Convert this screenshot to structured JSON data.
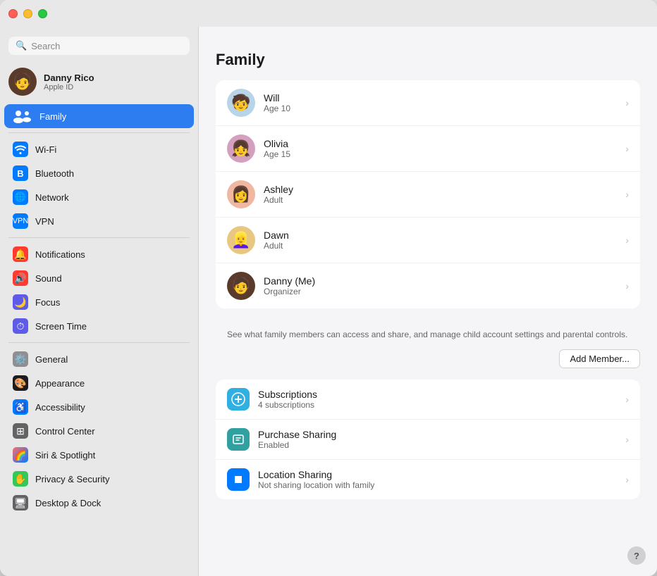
{
  "window": {
    "title": "Family"
  },
  "titlebar": {
    "red": "close",
    "yellow": "minimize",
    "green": "maximize"
  },
  "sidebar": {
    "search": {
      "placeholder": "Search"
    },
    "user": {
      "name": "Danny Rico",
      "subtitle": "Apple ID"
    },
    "items": [
      {
        "id": "family",
        "label": "Family",
        "icon": "family",
        "active": true
      },
      {
        "id": "wifi",
        "label": "Wi-Fi",
        "icon": "wifi"
      },
      {
        "id": "bluetooth",
        "label": "Bluetooth",
        "icon": "bluetooth"
      },
      {
        "id": "network",
        "label": "Network",
        "icon": "network"
      },
      {
        "id": "vpn",
        "label": "VPN",
        "icon": "vpn"
      },
      {
        "id": "notifications",
        "label": "Notifications",
        "icon": "notifications"
      },
      {
        "id": "sound",
        "label": "Sound",
        "icon": "sound"
      },
      {
        "id": "focus",
        "label": "Focus",
        "icon": "focus"
      },
      {
        "id": "screentime",
        "label": "Screen Time",
        "icon": "screentime"
      },
      {
        "id": "general",
        "label": "General",
        "icon": "general"
      },
      {
        "id": "appearance",
        "label": "Appearance",
        "icon": "appearance"
      },
      {
        "id": "accessibility",
        "label": "Accessibility",
        "icon": "accessibility"
      },
      {
        "id": "controlcenter",
        "label": "Control Center",
        "icon": "controlcenter"
      },
      {
        "id": "siri",
        "label": "Siri & Spotlight",
        "icon": "siri"
      },
      {
        "id": "privacy",
        "label": "Privacy & Security",
        "icon": "privacy"
      },
      {
        "id": "desktop",
        "label": "Desktop & Dock",
        "icon": "desktop"
      }
    ]
  },
  "main": {
    "title": "Family",
    "members": [
      {
        "name": "Will",
        "sub": "Age 10",
        "emoji": "🧒",
        "color": "av-will"
      },
      {
        "name": "Olivia",
        "sub": "Age 15",
        "emoji": "👧",
        "color": "av-olivia"
      },
      {
        "name": "Ashley",
        "sub": "Adult",
        "emoji": "👩",
        "color": "av-ashley"
      },
      {
        "name": "Dawn",
        "sub": "Adult",
        "emoji": "👱‍♀️",
        "color": "av-dawn"
      },
      {
        "name": "Danny (Me)",
        "sub": "Organizer",
        "emoji": "🧑",
        "color": "av-danny"
      }
    ],
    "description": "See what family members can access and share, and manage child account settings and parental controls.",
    "add_member_label": "Add Member...",
    "services": [
      {
        "name": "Subscriptions",
        "sub": "4 subscriptions",
        "icon": "➕",
        "color": "subs-icon"
      },
      {
        "name": "Purchase Sharing",
        "sub": "Enabled",
        "icon": "🅿",
        "color": "purchase-icon"
      },
      {
        "name": "Location Sharing",
        "sub": "Not sharing location with family",
        "icon": "➤",
        "color": "location-icon"
      }
    ],
    "help_label": "?"
  }
}
